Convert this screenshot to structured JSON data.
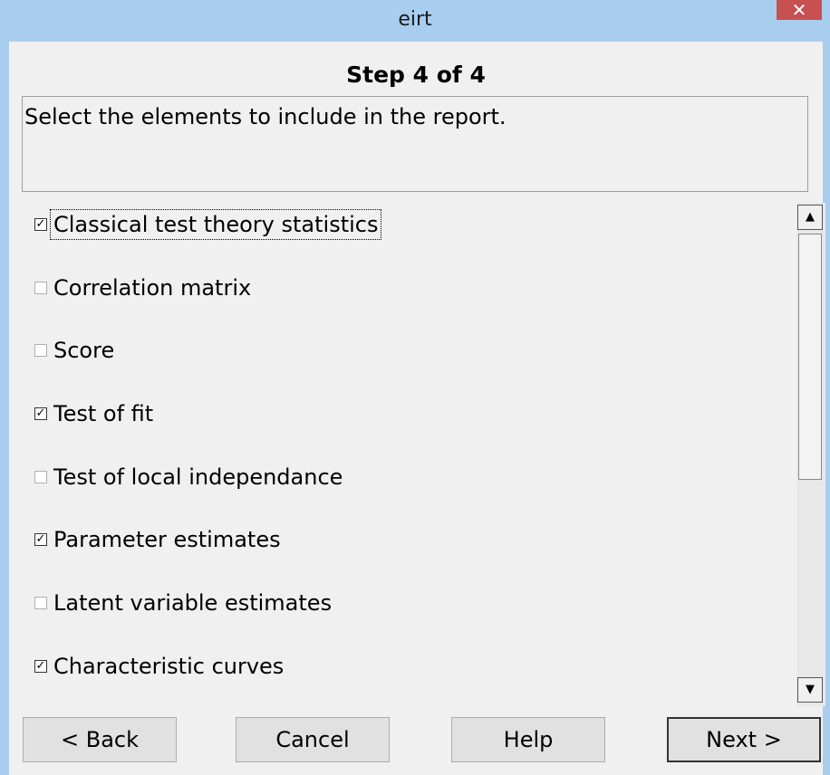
{
  "window": {
    "title": "eirt",
    "close_glyph": "✕"
  },
  "wizard": {
    "step": "Step 4 of 4",
    "description": "Select the elements to include in the report."
  },
  "options": [
    {
      "label": "Classical test theory statistics",
      "checked": true
    },
    {
      "label": "Correlation matrix",
      "checked": false
    },
    {
      "label": "Score",
      "checked": false
    },
    {
      "label": "Test of fit",
      "checked": true
    },
    {
      "label": "Test of local independance",
      "checked": false
    },
    {
      "label": "Parameter estimates",
      "checked": true
    },
    {
      "label": "Latent variable estimates",
      "checked": false
    },
    {
      "label": "Characteristic curves",
      "checked": true
    }
  ],
  "scrollbar": {
    "up_glyph": "▲",
    "down_glyph": "▼"
  },
  "buttons": {
    "back": "< Back",
    "cancel": "Cancel",
    "help": "Help",
    "next": "Next >"
  }
}
